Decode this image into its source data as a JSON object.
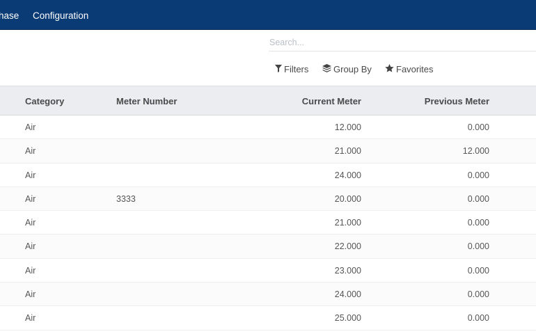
{
  "topnav": {
    "menu": [
      {
        "label": "hase"
      },
      {
        "label": "Configuration"
      }
    ]
  },
  "search": {
    "placeholder": "Search...",
    "value": ""
  },
  "filters": {
    "filters_label": "Filters",
    "groupby_label": "Group By",
    "favorites_label": "Favorites",
    "icons": [
      "filter-icon",
      "layers-icon",
      "star-icon"
    ]
  },
  "table": {
    "columns": [
      "Category",
      "Meter Number",
      "Current Meter",
      "Previous Meter"
    ],
    "rows": [
      {
        "category": "Air",
        "meter_number": "",
        "current": "12.000",
        "previous": "0.000"
      },
      {
        "category": "Air",
        "meter_number": "",
        "current": "21.000",
        "previous": "12.000"
      },
      {
        "category": "Air",
        "meter_number": "",
        "current": "24.000",
        "previous": "0.000"
      },
      {
        "category": "Air",
        "meter_number": "3333",
        "current": "20.000",
        "previous": "0.000"
      },
      {
        "category": "Air",
        "meter_number": "",
        "current": "21.000",
        "previous": "0.000"
      },
      {
        "category": "Air",
        "meter_number": "",
        "current": "22.000",
        "previous": "0.000"
      },
      {
        "category": "Air",
        "meter_number": "",
        "current": "23.000",
        "previous": "0.000"
      },
      {
        "category": "Air",
        "meter_number": "",
        "current": "24.000",
        "previous": "0.000"
      },
      {
        "category": "Air",
        "meter_number": "",
        "current": "25.000",
        "previous": "0.000"
      }
    ]
  },
  "colors": {
    "navbar": "#0b3b75",
    "header_bg": "#ebedf0"
  }
}
